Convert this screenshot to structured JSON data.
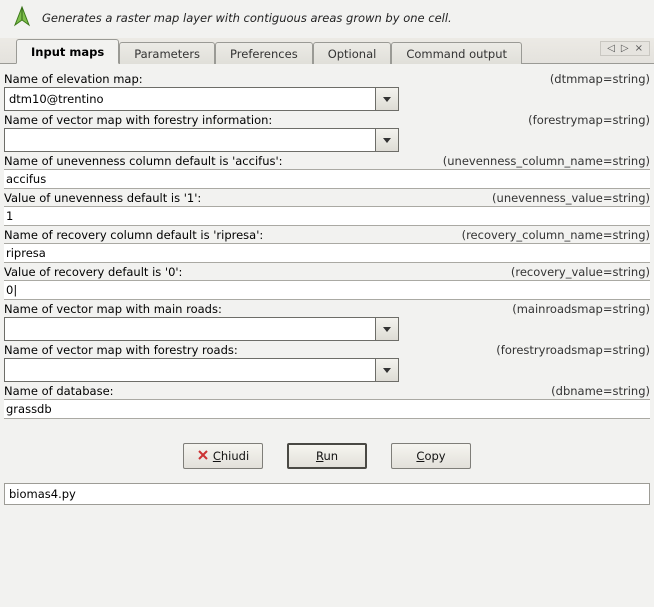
{
  "header": {
    "description": "Generates a raster map layer with contiguous areas grown by one cell."
  },
  "tabs": {
    "input_maps": "Input maps",
    "parameters": "Parameters",
    "preferences": "Preferences",
    "optional": "Optional",
    "command_output": "Command output"
  },
  "fields": {
    "elevation": {
      "label": "Name of elevation map:",
      "hint": "(dtmmap=string)",
      "value": "dtm10@trentino"
    },
    "forestry": {
      "label": "Name of vector map with forestry information:",
      "hint": "(forestrymap=string)",
      "value": ""
    },
    "uneven_col": {
      "label": "Name of unevenness column default is 'accifus':",
      "hint": "(unevenness_column_name=string)",
      "value": "accifus"
    },
    "uneven_val": {
      "label": "Value of unevenness default is '1':",
      "hint": "(unevenness_value=string)",
      "value": "1"
    },
    "recovery_col": {
      "label": "Name of recovery column default is 'ripresa':",
      "hint": "(recovery_column_name=string)",
      "value": "ripresa"
    },
    "recovery_val": {
      "label": "Value of recovery default is '0':",
      "hint": "(recovery_value=string)",
      "value": "0|"
    },
    "mainroads": {
      "label": "Name of vector map with main roads:",
      "hint": "(mainroadsmap=string)",
      "value": ""
    },
    "forestryroads": {
      "label": "Name of vector map with forestry roads:",
      "hint": "(forestryroadsmap=string)",
      "value": ""
    },
    "dbname": {
      "label": "Name of database:",
      "hint": "(dbname=string)",
      "value": "grassdb"
    }
  },
  "buttons": {
    "close_pre": "C",
    "close_post": "hiudi",
    "run_pre": "R",
    "run_post": "un",
    "copy_pre": "C",
    "copy_post": "opy"
  },
  "status": {
    "text": "biomas4.py"
  },
  "tab_ctrl": {
    "left": "◁",
    "right": "▷",
    "close": "×"
  }
}
